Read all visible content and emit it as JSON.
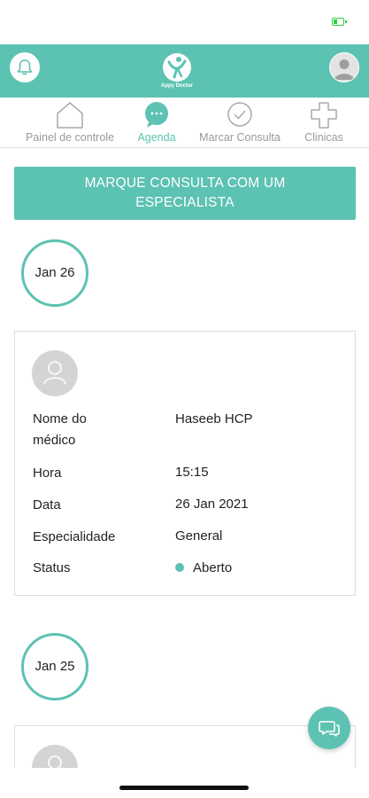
{
  "status_bar": {
    "battery_color": "#2ecc40",
    "battery_icon": "battery-icon"
  },
  "header": {
    "background_color": "#5cc2b2",
    "logo_text": "Appy Doctor",
    "left_icon": "bell-icon",
    "right_icon": "user-avatar-icon"
  },
  "tabs": [
    {
      "label": "Painel de controle",
      "icon": "home-icon",
      "active": false
    },
    {
      "label": "Agenda",
      "icon": "chat-bubble-icon",
      "active": true
    },
    {
      "label": "Marcar Consulta",
      "icon": "check-circle-icon",
      "active": false
    },
    {
      "label": "Clinicas",
      "icon": "plus-cross-icon",
      "active": false
    }
  ],
  "cta": {
    "line1": "MARQUE CONSULTA COM UM",
    "line2": "ESPECIALISTA"
  },
  "appointments": [
    {
      "date_badge": "Jan 26",
      "doctor_label_line1": "Nome do",
      "doctor_label_line2": "médico",
      "doctor_value": "Haseeb HCP",
      "time_label": "Hora",
      "time_value": "15:15",
      "date_label": "Data",
      "date_value": "26 Jan 2021",
      "specialty_label": "Especialidade",
      "specialty_value": "General",
      "status_label": "Status",
      "status_value": "Aberto",
      "status_color": "#5cc2b2"
    },
    {
      "date_badge": "Jan 25"
    }
  ],
  "fab": {
    "icon": "chat-icon"
  },
  "accent_color": "#5cc2b2"
}
